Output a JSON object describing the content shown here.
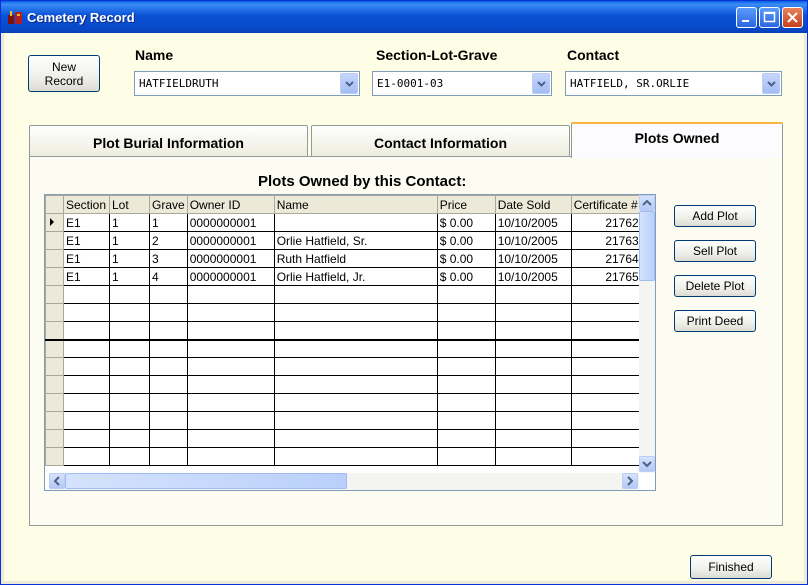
{
  "window": {
    "title": "Cemetery Record"
  },
  "toolbar": {
    "new_record_label": "New\nRecord",
    "finished_label": "Finished"
  },
  "fields": {
    "name": {
      "label": "Name",
      "value": "HATFIELDRUTH"
    },
    "section_lot_grave": {
      "label": "Section-Lot-Grave",
      "value": "E1-0001-03"
    },
    "contact": {
      "label": "Contact",
      "value": "HATFIELD, SR.ORLIE"
    }
  },
  "tabs": [
    {
      "label": "Plot Burial Information",
      "active": false
    },
    {
      "label": "Contact Information",
      "active": false
    },
    {
      "label": "Plots Owned",
      "active": true
    }
  ],
  "grid": {
    "title": "Plots Owned by this Contact:",
    "columns": [
      "Section",
      "Lot",
      "Grave",
      "Owner ID",
      "Name",
      "Price",
      "Date Sold",
      "Certificate #"
    ],
    "rows": [
      [
        "E1",
        "1",
        "1",
        "0000000001",
        "",
        "$  0.00",
        "10/10/2005",
        "21762"
      ],
      [
        "E1",
        "1",
        "2",
        "0000000001",
        "Orlie Hatfield, Sr.",
        "$  0.00",
        "10/10/2005",
        "21763"
      ],
      [
        "E1",
        "1",
        "3",
        "0000000001",
        "Ruth Hatfield",
        "$  0.00",
        "10/10/2005",
        "21764"
      ],
      [
        "E1",
        "1",
        "4",
        "0000000001",
        "Orlie Hatfield, Jr.",
        "$  0.00",
        "10/10/2005",
        "21765"
      ]
    ],
    "empty_rows": 10
  },
  "actions": {
    "add_plot": "Add Plot",
    "sell_plot": "Sell Plot",
    "delete_plot": "Delete Plot",
    "print_deed": "Print Deed"
  },
  "icons": {
    "app": "cemetery-app-icon",
    "minimize": "minimize-icon",
    "maximize": "maximize-icon",
    "close": "close-icon"
  },
  "colors": {
    "titlebar": "#0a52d7",
    "client_bg": "#fefee6",
    "active_tab_accent": "#f8b640"
  }
}
